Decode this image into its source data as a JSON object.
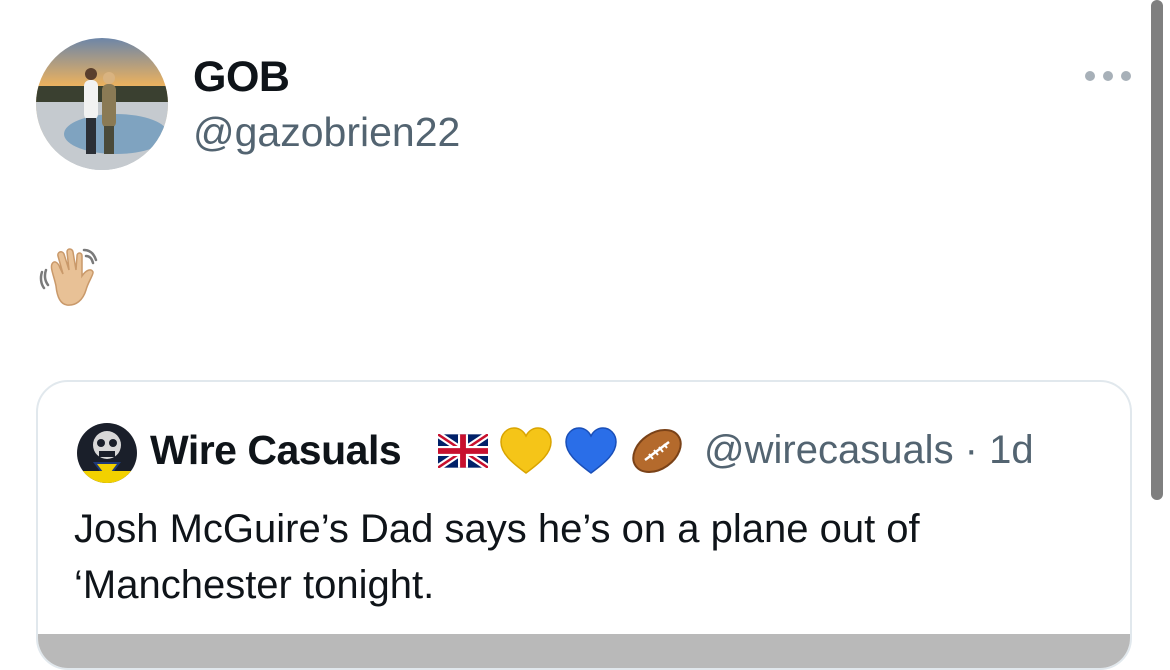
{
  "post": {
    "author_name": "GOB",
    "author_handle": "@gazobrien22",
    "text_emoji": "waving-hand-emoji"
  },
  "quote": {
    "author_name": "Wire Casuals",
    "emojis": [
      "uk-flag-icon",
      "yellow-heart-icon",
      "blue-heart-icon",
      "rugby-ball-icon"
    ],
    "author_handle": "@wirecasuals",
    "separator": "·",
    "time": "1d",
    "meta": "@wirecasuals · 1d",
    "text": "Josh McGuire’s Dad says he’s on a plane out of ‘Manchester tonight."
  },
  "colors": {
    "text_primary": "#0f1419",
    "text_secondary": "#536471",
    "card_border": "#e1e8ed",
    "scrollbar": "#7f7f7f"
  }
}
